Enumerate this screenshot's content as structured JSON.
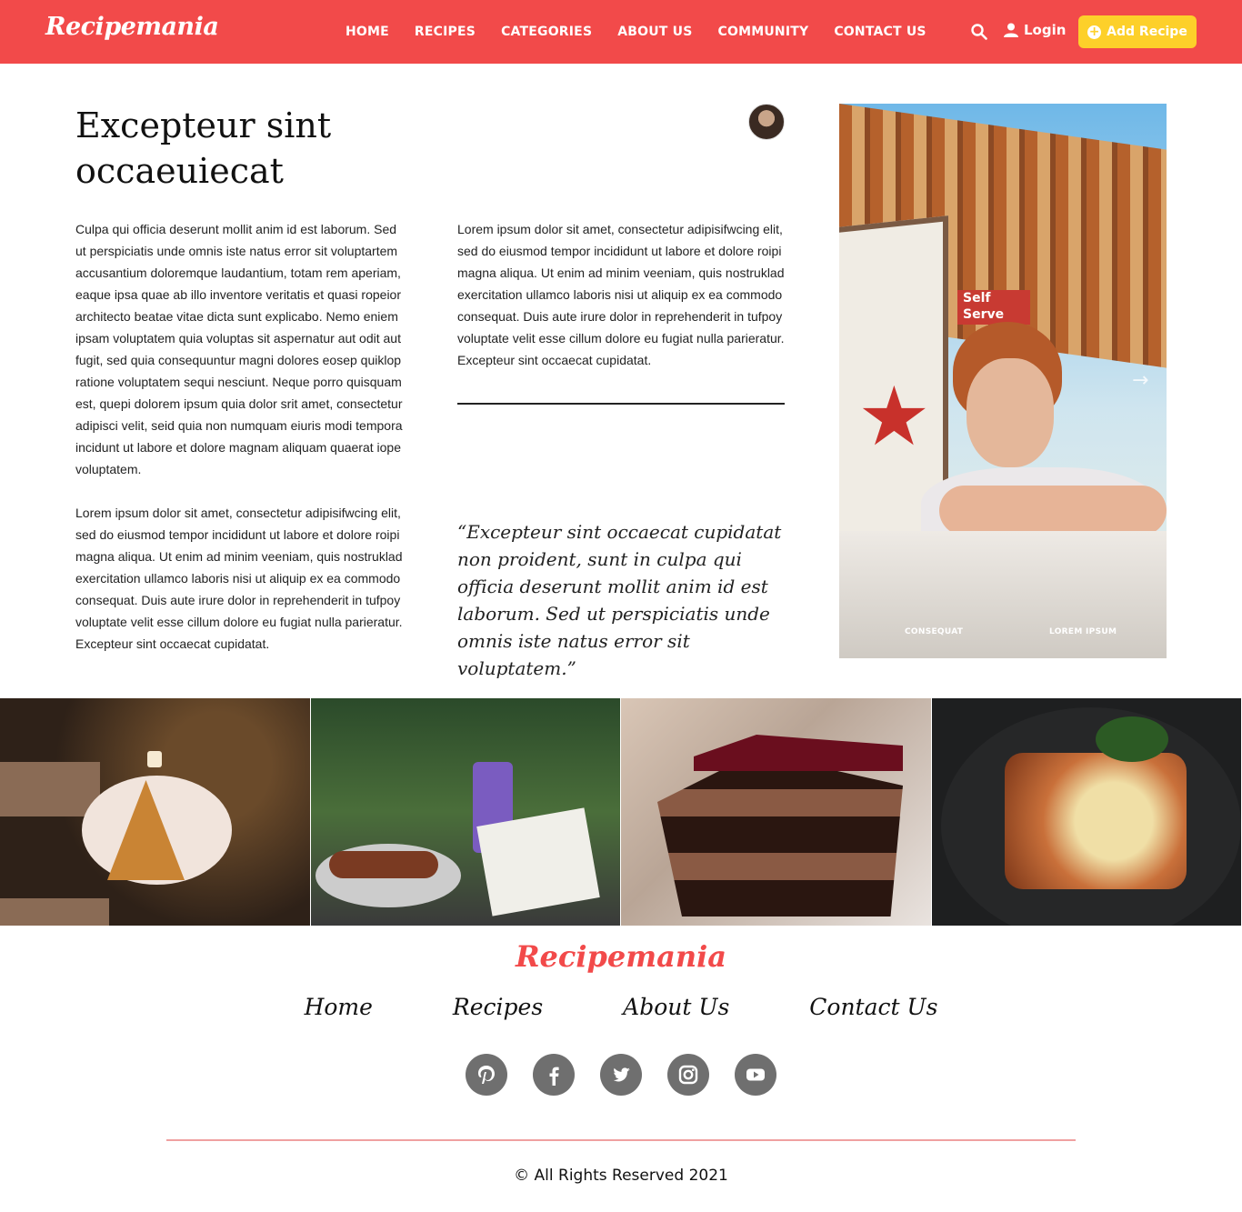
{
  "brand": {
    "name": "Recipemania",
    "accent": "#f24a4a",
    "button_color": "#fdd02a"
  },
  "nav": {
    "items": [
      "HOME",
      "RECIPES",
      "CATEGORIES",
      "ABOUT US",
      "COMMUNITY",
      "CONTACT US"
    ],
    "search_icon": "search-icon",
    "login_label": "Login",
    "add_recipe_label": "Add Recipe"
  },
  "article": {
    "title": "Excepteur sint occaeuiecat",
    "paragraph1": "Culpa qui officia deserunt mollit anim id est laborum. Sed ut perspiciatis unde omnis iste natus error sit voluptartem accusantium doloremque laudantium, totam rem aperiam, eaque ipsa quae ab illo inventore veritatis et quasi ropeior architecto beatae vitae dicta sunt explicabo. Nemo eniem ipsam voluptatem quia voluptas sit aspernatur aut odit aut fugit, sed quia consequuntur magni dolores eosep quiklop ratione voluptatem sequi nesciunt. Neque porro quisquam est, quepi dolorem ipsum quia dolor srit amet, consectetur adipisci velit, seid quia non numquam eiuris modi tempora incidunt ut labore et dolore magnam aliquam quaerat iope voluptatem.",
    "paragraph2": "Lorem ipsum dolor sit amet, consectetur adipisifwcing elit, sed do eiusmod tempor incididunt ut labore et dolore roipi magna aliqua. Ut enim ad minim veeniam, quis nostruklad exercitation ullamco laboris nisi ut aliquip ex ea commodo consequat. Duis aute irure dolor in reprehenderit in tufpoy voluptate velit esse cillum dolore eu fugiat nulla parieratur. Excepteur sint occaecat cupidatat.",
    "paragraph3": "Lorem ipsum dolor sit amet, consectetur adipisifwcing elit, sed do eiusmod tempor incididunt ut labore et dolore roipi magna aliqua. Ut enim ad minim veeniam, quis nostruklad exercitation ullamco laboris nisi ut aliquip ex ea commodo consequat. Duis aute irure dolor in reprehenderit in tufpoy voluptate velit esse cillum dolore eu fugiat nulla parieratur. Excepteur sint occaecat cupidatat.",
    "quote": "“Excepteur sint occaecat cupidatat non proident, sunt in culpa qui officia deserunt mollit anim id est laborum. Sed ut perspiciatis unde omnis iste natus error sit voluptatem.”"
  },
  "hero": {
    "sign_text": "Self Serve",
    "caption1": "CONSEQUAT",
    "caption2": "LOREM IPSUM"
  },
  "footer": {
    "logo": "Recipemania",
    "links": [
      "Home",
      "Recipes",
      "About Us",
      "Contact Us"
    ],
    "socials": [
      "pinterest-icon",
      "facebook-icon",
      "twitter-icon",
      "instagram-icon",
      "youtube-icon"
    ],
    "copyright": "© All Rights Reserved 2021"
  }
}
